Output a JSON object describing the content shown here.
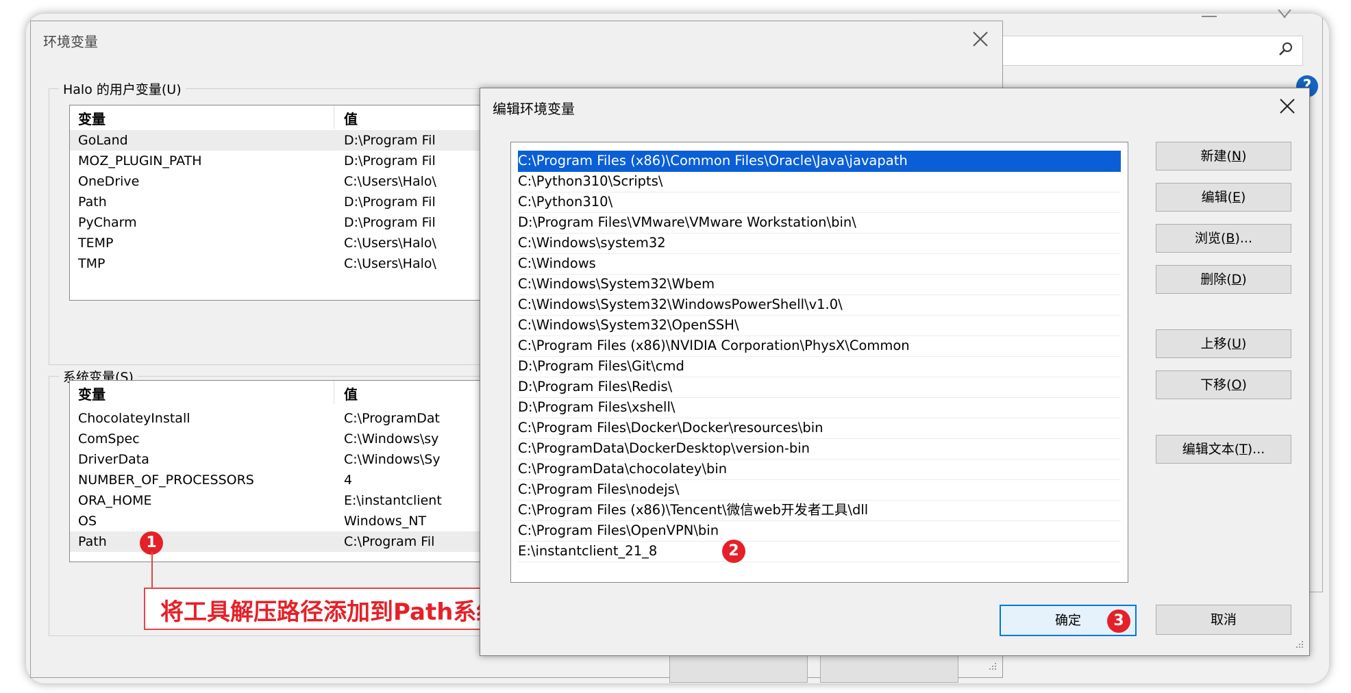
{
  "env_dialog": {
    "title": "环境变量",
    "user_group_label": "Halo 的用户变量(U)",
    "user_table": {
      "col_var": "变量",
      "col_val": "值",
      "rows": [
        {
          "name": "GoLand",
          "value": "D:\\Program Fil"
        },
        {
          "name": "MOZ_PLUGIN_PATH",
          "value": "D:\\Program Fil"
        },
        {
          "name": "OneDrive",
          "value": "C:\\Users\\Halo\\"
        },
        {
          "name": "Path",
          "value": "D:\\Program Fil"
        },
        {
          "name": "PyCharm",
          "value": "D:\\Program Fil"
        },
        {
          "name": "TEMP",
          "value": "C:\\Users\\Halo\\"
        },
        {
          "name": "TMP",
          "value": "C:\\Users\\Halo\\"
        }
      ]
    },
    "system_group_label": "系统变量(S)",
    "system_table": {
      "col_var": "变量",
      "col_val": "值",
      "rows": [
        {
          "name": "ChocolateyInstall",
          "value": "C:\\ProgramDat"
        },
        {
          "name": "ComSpec",
          "value": "C:\\Windows\\sy"
        },
        {
          "name": "DriverData",
          "value": "C:\\Windows\\Sy"
        },
        {
          "name": "NUMBER_OF_PROCESSORS",
          "value": "4"
        },
        {
          "name": "ORA_HOME",
          "value": "E:\\instantclient"
        },
        {
          "name": "OS",
          "value": "Windows_NT"
        },
        {
          "name": "Path",
          "value": "C:\\Program Fil"
        }
      ]
    }
  },
  "edit_dialog": {
    "title": "编辑环境变量",
    "paths": [
      "C:\\Program Files (x86)\\Common Files\\Oracle\\Java\\javapath",
      "C:\\Python310\\Scripts\\",
      "C:\\Python310\\",
      "D:\\Program Files\\VMware\\VMware Workstation\\bin\\",
      "C:\\Windows\\system32",
      "C:\\Windows",
      "C:\\Windows\\System32\\Wbem",
      "C:\\Windows\\System32\\WindowsPowerShell\\v1.0\\",
      "C:\\Windows\\System32\\OpenSSH\\",
      "C:\\Program Files (x86)\\NVIDIA Corporation\\PhysX\\Common",
      "D:\\Program Files\\Git\\cmd",
      "D:\\Program Files\\Redis\\",
      "D:\\Program Files\\xshell\\",
      "C:\\Program Files\\Docker\\Docker\\resources\\bin",
      "C:\\ProgramData\\DockerDesktop\\version-bin",
      "C:\\ProgramData\\chocolatey\\bin",
      "C:\\Program Files\\nodejs\\",
      "C:\\Program Files (x86)\\Tencent\\微信web开发者工具\\dll",
      "C:\\Program Files\\OpenVPN\\bin",
      "E:\\instantclient_21_8"
    ],
    "buttons": {
      "new_text": "新建(",
      "new_key": "N",
      "edit_text": "编辑(",
      "edit_key": "E",
      "browse_text": "浏览(",
      "browse_key": "B",
      "browse_suffix": ")...",
      "delete_text": "删除(",
      "delete_key": "D",
      "up_text": "上移(",
      "up_key": "U",
      "down_text": "下移(",
      "down_key": "O",
      "edit_text_text": "编辑文本(",
      "edit_text_key": "T",
      "edit_text_suffix": ")...",
      "close_paren": ")"
    },
    "ok_label": "确定",
    "cancel_label": "取消"
  },
  "annotations": {
    "badge1": "1",
    "badge2": "2",
    "badge3": "3",
    "callout_text": "将工具解压路径添加到Path系统变量中"
  },
  "colors": {
    "selection": "#0a5fd6",
    "badge": "#e62028",
    "ok_border": "#0078d7"
  }
}
